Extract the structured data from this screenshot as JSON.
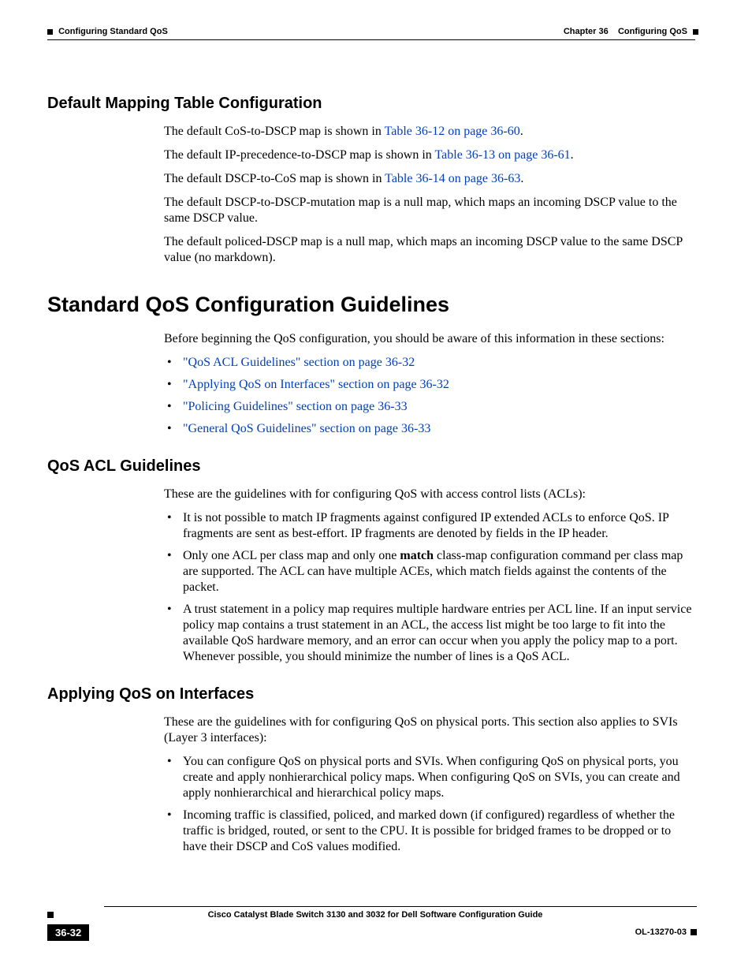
{
  "header": {
    "chapter": "Chapter 36",
    "chapter_title": "Configuring QoS",
    "section": "Configuring Standard QoS"
  },
  "s1": {
    "title": "Default Mapping Table Configuration",
    "p1a": "The default CoS-to-DSCP map is shown in ",
    "p1l": "Table 36-12 on page 36-60",
    "p1b": ".",
    "p2a": "The default IP-precedence-to-DSCP map is shown in ",
    "p2l": "Table 36-13 on page 36-61",
    "p2b": ".",
    "p3a": "The default DSCP-to-CoS map is shown in ",
    "p3l": "Table 36-14 on page 36-63",
    "p3b": ".",
    "p4": "The default DSCP-to-DSCP-mutation map is a null map, which maps an incoming DSCP value to the same DSCP value.",
    "p5": "The default policed-DSCP map is a null map, which maps an incoming DSCP value to the same DSCP value (no markdown)."
  },
  "s2": {
    "title": "Standard QoS Configuration Guidelines",
    "intro": "Before beginning the QoS configuration, you should be aware of this information in these sections:",
    "links": [
      "\"QoS ACL Guidelines\" section on page 36-32",
      "\"Applying QoS on Interfaces\" section on page 36-32",
      "\"Policing Guidelines\" section on page 36-33",
      "\"General QoS Guidelines\" section on page 36-33"
    ]
  },
  "s3": {
    "title": "QoS ACL Guidelines",
    "intro": "These are the guidelines with for configuring QoS with access control lists (ACLs):",
    "b1": "It is not possible to match IP fragments against configured IP extended ACLs to enforce QoS. IP fragments are sent as best-effort. IP fragments are denoted by fields in the IP header.",
    "b2a": "Only one ACL per class map and only one ",
    "b2m": "match",
    "b2b": " class-map configuration command per class map are supported. The ACL can have multiple ACEs, which match fields against the contents of the packet.",
    "b3": "A trust statement in a policy map requires multiple hardware entries per ACL line. If an input service policy map contains a trust statement in an ACL, the access list might be too large to fit into the available QoS hardware memory, and an error can occur when you apply the policy map to a port. Whenever possible, you should minimize the number of lines is a QoS ACL."
  },
  "s4": {
    "title": "Applying QoS on Interfaces",
    "intro": "These are the guidelines with for configuring QoS on physical ports. This section also applies to SVIs (Layer 3 interfaces):",
    "b1": "You can configure QoS on physical ports and SVIs. When configuring QoS on physical ports, you create and apply nonhierarchical policy maps. When configuring QoS on SVIs, you can create and apply nonhierarchical and hierarchical policy maps.",
    "b2": "Incoming traffic is classified, policed, and marked down (if configured) regardless of whether the traffic is bridged, routed, or sent to the CPU. It is possible for bridged frames to be dropped or to have their DSCP and CoS values modified."
  },
  "footer": {
    "guide": "Cisco Catalyst Blade Switch 3130 and 3032 for Dell Software Configuration Guide",
    "page": "36-32",
    "docid": "OL-13270-03"
  }
}
